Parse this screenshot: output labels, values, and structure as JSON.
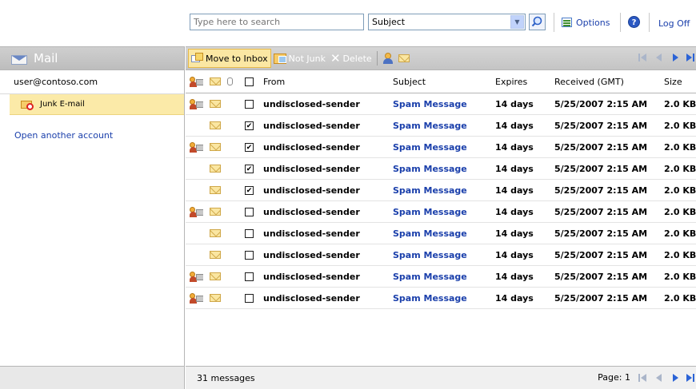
{
  "search": {
    "placeholder": "Type here to search",
    "scope_value": "Subject"
  },
  "top_links": {
    "options": "Options",
    "logoff": "Log Off"
  },
  "sidebar": {
    "title": "Mail",
    "account": "user@contoso.com",
    "folder": "Junk E-mail",
    "open_another": "Open another account"
  },
  "toolbar": {
    "move_to_inbox": "Move to Inbox",
    "not_junk": "Not Junk",
    "delete": "Delete"
  },
  "columns": {
    "from": "From",
    "subject": "Subject",
    "expires": "Expires",
    "received": "Received (GMT)",
    "size": "Size"
  },
  "messages": [
    {
      "type": "people",
      "checked": false,
      "from": "undisclosed-sender",
      "subject": "Spam Message",
      "expires": "14 days",
      "received": "5/25/2007 2:15 AM",
      "size": "2.0 KB"
    },
    {
      "type": "none",
      "checked": true,
      "from": "undisclosed-sender",
      "subject": "Spam Message",
      "expires": "14 days",
      "received": "5/25/2007 2:15 AM",
      "size": "2.0 KB"
    },
    {
      "type": "people",
      "checked": true,
      "from": "undisclosed-sender",
      "subject": "Spam Message",
      "expires": "14 days",
      "received": "5/25/2007 2:15 AM",
      "size": "2.0 KB"
    },
    {
      "type": "none",
      "checked": true,
      "from": "undisclosed-sender",
      "subject": "Spam Message",
      "expires": "14 days",
      "received": "5/25/2007 2:15 AM",
      "size": "2.0 KB"
    },
    {
      "type": "none",
      "checked": true,
      "from": "undisclosed-sender",
      "subject": "Spam Message",
      "expires": "14 days",
      "received": "5/25/2007 2:15 AM",
      "size": "2.0 KB"
    },
    {
      "type": "people",
      "checked": false,
      "from": "undisclosed-sender",
      "subject": "Spam Message",
      "expires": "14 days",
      "received": "5/25/2007 2:15 AM",
      "size": "2.0 KB"
    },
    {
      "type": "none",
      "checked": false,
      "from": "undisclosed-sender",
      "subject": "Spam Message",
      "expires": "14 days",
      "received": "5/25/2007 2:15 AM",
      "size": "2.0 KB"
    },
    {
      "type": "none",
      "checked": false,
      "from": "undisclosed-sender",
      "subject": "Spam Message",
      "expires": "14 days",
      "received": "5/25/2007 2:15 AM",
      "size": "2.0 KB"
    },
    {
      "type": "people",
      "checked": false,
      "from": "undisclosed-sender",
      "subject": "Spam Message",
      "expires": "14 days",
      "received": "5/25/2007 2:15 AM",
      "size": "2.0 KB"
    },
    {
      "type": "people",
      "checked": false,
      "from": "undisclosed-sender",
      "subject": "Spam Message",
      "expires": "14 days",
      "received": "5/25/2007 2:15 AM",
      "size": "2.0 KB"
    }
  ],
  "footer": {
    "count": "31 messages",
    "page_label": "Page: 1"
  }
}
